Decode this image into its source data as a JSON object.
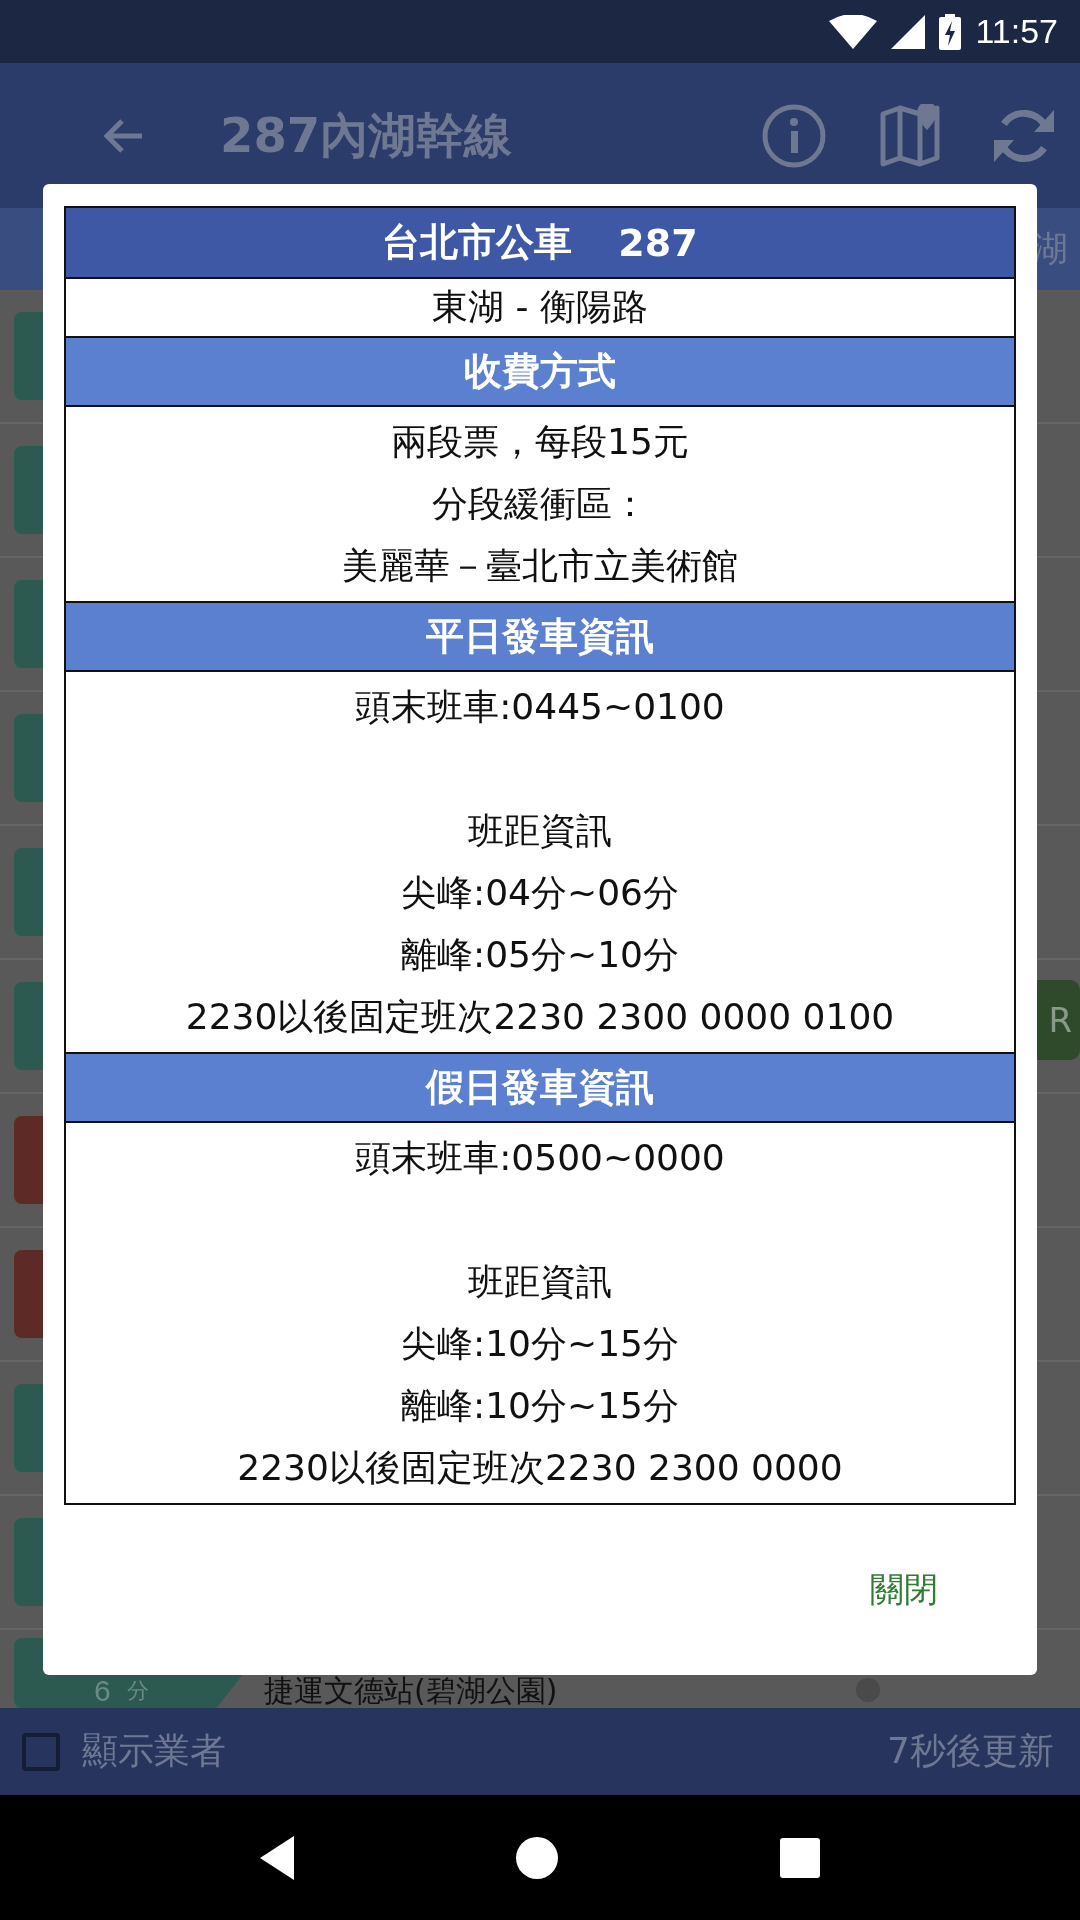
{
  "status_bar": {
    "time": "11:57"
  },
  "app_bar": {
    "title": "287內湖幹線"
  },
  "tab_strip": {
    "partial_tab": "湖"
  },
  "list_rows": [
    {
      "color": "#2c5a50"
    },
    {
      "color": "#2c5a50"
    },
    {
      "color": "#2c5a50"
    },
    {
      "color": "#2c5a50"
    },
    {
      "color": "#2c5a50"
    },
    {
      "color": "#2c5a50",
      "chip": "R"
    },
    {
      "color": "#5e2a25"
    },
    {
      "color": "#5e2a25"
    },
    {
      "color": "#2c5a50"
    },
    {
      "color": "#2c5a50"
    },
    {
      "color": "#2c5a50",
      "minutes": "6",
      "unit": "分",
      "stop": "捷運文德站(碧湖公園)"
    }
  ],
  "bottom_bar": {
    "checkbox_label": "顯示業者",
    "checked": false,
    "refresh_note": "7秒後更新"
  },
  "dialog": {
    "title": "台北市公車",
    "route_number": "287",
    "route": "東湖 - 衡陽路",
    "sections": [
      {
        "heading": "收費方式",
        "paragraphs": [
          [
            "兩段票，每段15元",
            "分段緩衝區：",
            "美麗華－臺北市立美術館"
          ]
        ]
      },
      {
        "heading": "平日發車資訊",
        "paragraphs": [
          [
            "頭末班車:0445~0100"
          ],
          [
            "班距資訊",
            "尖峰:04分~06分",
            "離峰:05分~10分",
            "2230以後固定班次2230 2300 0000 0100"
          ]
        ]
      },
      {
        "heading": "假日發車資訊",
        "paragraphs": [
          [
            "頭末班車:0500~0000"
          ],
          [
            "班距資訊",
            "尖峰:10分~15分",
            "離峰:10分~15分",
            "2230以後固定班次2230 2300 0000"
          ]
        ]
      }
    ],
    "close_button": "關閉"
  }
}
